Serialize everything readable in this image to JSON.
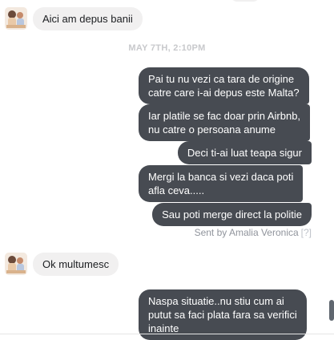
{
  "conversation": {
    "incoming_1": "Aici am depus banii",
    "timestamp": "MAY 7TH, 2:10PM",
    "outgoing": [
      "Pai tu nu vezi ca tara de origine\ncatre care i-ai depus este Malta?",
      "Iar platile se fac doar prin Airbnb,\nnu catre o persoana anume",
      "Deci ti-ai luat teapa sigur",
      "Mergi la banca si vezi daca poti\nafla ceva.....",
      "Sau poti merge direct la politie"
    ],
    "sent_by": "Sent by Amalia Veronica",
    "sent_by_help": "[?]",
    "incoming_2": "Ok multumesc",
    "outgoing_last": "Naspa situatie..nu stiu cum ai\nputut sa faci plata fara sa verifici\ninainte"
  },
  "colors": {
    "outgoing_bubble": "#474b52",
    "incoming_bubble": "#f1f0f0",
    "timestamp_text": "#c8c9cc",
    "meta_text": "#90949c"
  },
  "icons": {
    "avatar": "user-avatar-photo"
  }
}
